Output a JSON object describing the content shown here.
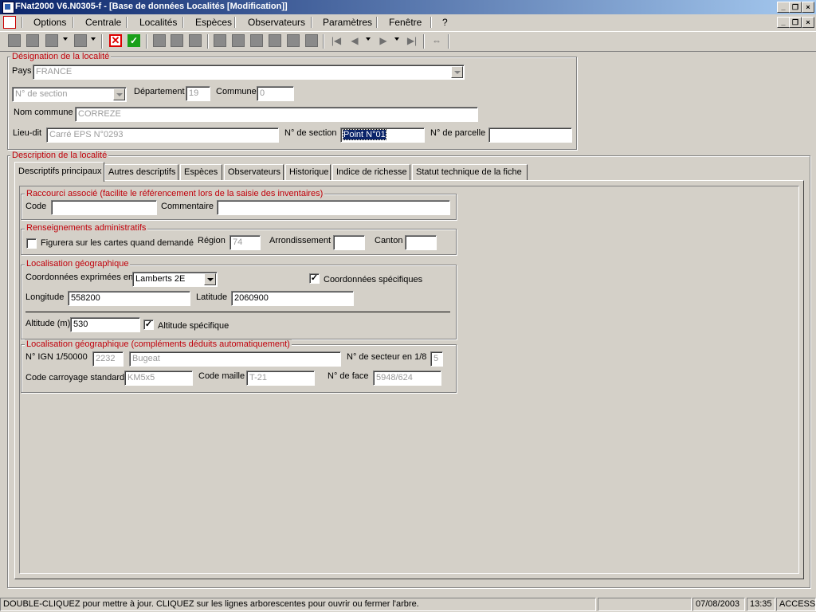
{
  "window": {
    "title": "FNat2000 V6.N0305-f - [Base de données Localités [Modification]]"
  },
  "menu": [
    "Options",
    "Centrale",
    "Localités",
    "Espèces",
    "Observateurs",
    "Paramètres",
    "Fenêtre",
    "?"
  ],
  "toolbar": {
    "icons": [
      "record-icon",
      "square-icon",
      "square-icon",
      "square-icon",
      "cancel-icon",
      "validate-icon",
      "cube-icon",
      "page-icon",
      "copy-icon",
      "grid-icon",
      "grid-icon",
      "grid-icon",
      "grid-icon",
      "export-icon",
      "print-icon",
      "first-icon",
      "previous-icon",
      "next-icon",
      "last-icon",
      "link-icon"
    ]
  },
  "designation": {
    "title": "Désignation de la localité",
    "pays_label": "Pays",
    "pays_value": "FRANCE",
    "section_select": "N° de section",
    "departement_label": "Département",
    "departement_value": "19",
    "commune_label": "Commune",
    "commune_value": "0",
    "nom_commune_label": "Nom commune",
    "nom_commune_value": "CORREZE",
    "lieu_dit_label": "Lieu-dit",
    "lieu_dit_value": "Carré EPS N°0293",
    "num_section_label": "N° de section",
    "num_section_value": "Point N°01",
    "num_parcelle_label": "N° de parcelle",
    "num_parcelle_value": ""
  },
  "description": {
    "title": "Description de la localité",
    "tabs": [
      "Descriptifs principaux",
      "Autres descriptifs",
      "Espèces",
      "Observateurs",
      "Historique",
      "Indice de richesse",
      "Statut technique de la fiche"
    ],
    "active_tab": 0
  },
  "raccourci": {
    "title": "Raccourci associé (facilite le référencement lors de la saisie des inventaires)",
    "code_label": "Code",
    "code_value": "",
    "commentaire_label": "Commentaire",
    "commentaire_value": ""
  },
  "administratif": {
    "title": "Renseignements administratifs",
    "figurera_label": "Figurera sur les cartes quand demandé",
    "figurera_checked": false,
    "region_label": "Région",
    "region_value": "74",
    "arrondissement_label": "Arrondissement",
    "arrondissement_value": "",
    "canton_label": "Canton",
    "canton_value": ""
  },
  "geo": {
    "title": "Localisation géographique",
    "coord_label": "Coordonnées exprimées en",
    "coord_value": "Lamberts 2E",
    "coord_spec_label": "Coordonnées spécifiques",
    "coord_spec_checked": "✓",
    "longitude_label": "Longitude",
    "longitude_value": "558200",
    "latitude_label": "Latitude",
    "latitude_value": "2060900",
    "altitude_label": "Altitude (m)",
    "altitude_value": "530",
    "altitude_spec_label": "Altitude spécifique",
    "altitude_spec_checked": "✓"
  },
  "geo_auto": {
    "title": "Localisation géographique (compléments déduits automatiquement)",
    "ign_label": "N° IGN 1/50000",
    "ign_value": "2232",
    "ign_name": "Bugeat",
    "secteur_label": "N° de secteur en 1/8",
    "secteur_value": "5",
    "carroyage_label": "Code carroyage standard",
    "carroyage_value": "KM5x5",
    "maille_label": "Code maille",
    "maille_value": "T-21",
    "face_label": "N° de face",
    "face_value": "5948/624"
  },
  "status": {
    "message": "DOUBLE-CLIQUEZ pour mettre à jour. CLIQUEZ sur les lignes arborescentes pour ouvrir ou fermer l'arbre.",
    "date": "07/08/2003",
    "time": "13:35",
    "mode": "ACCESS"
  }
}
